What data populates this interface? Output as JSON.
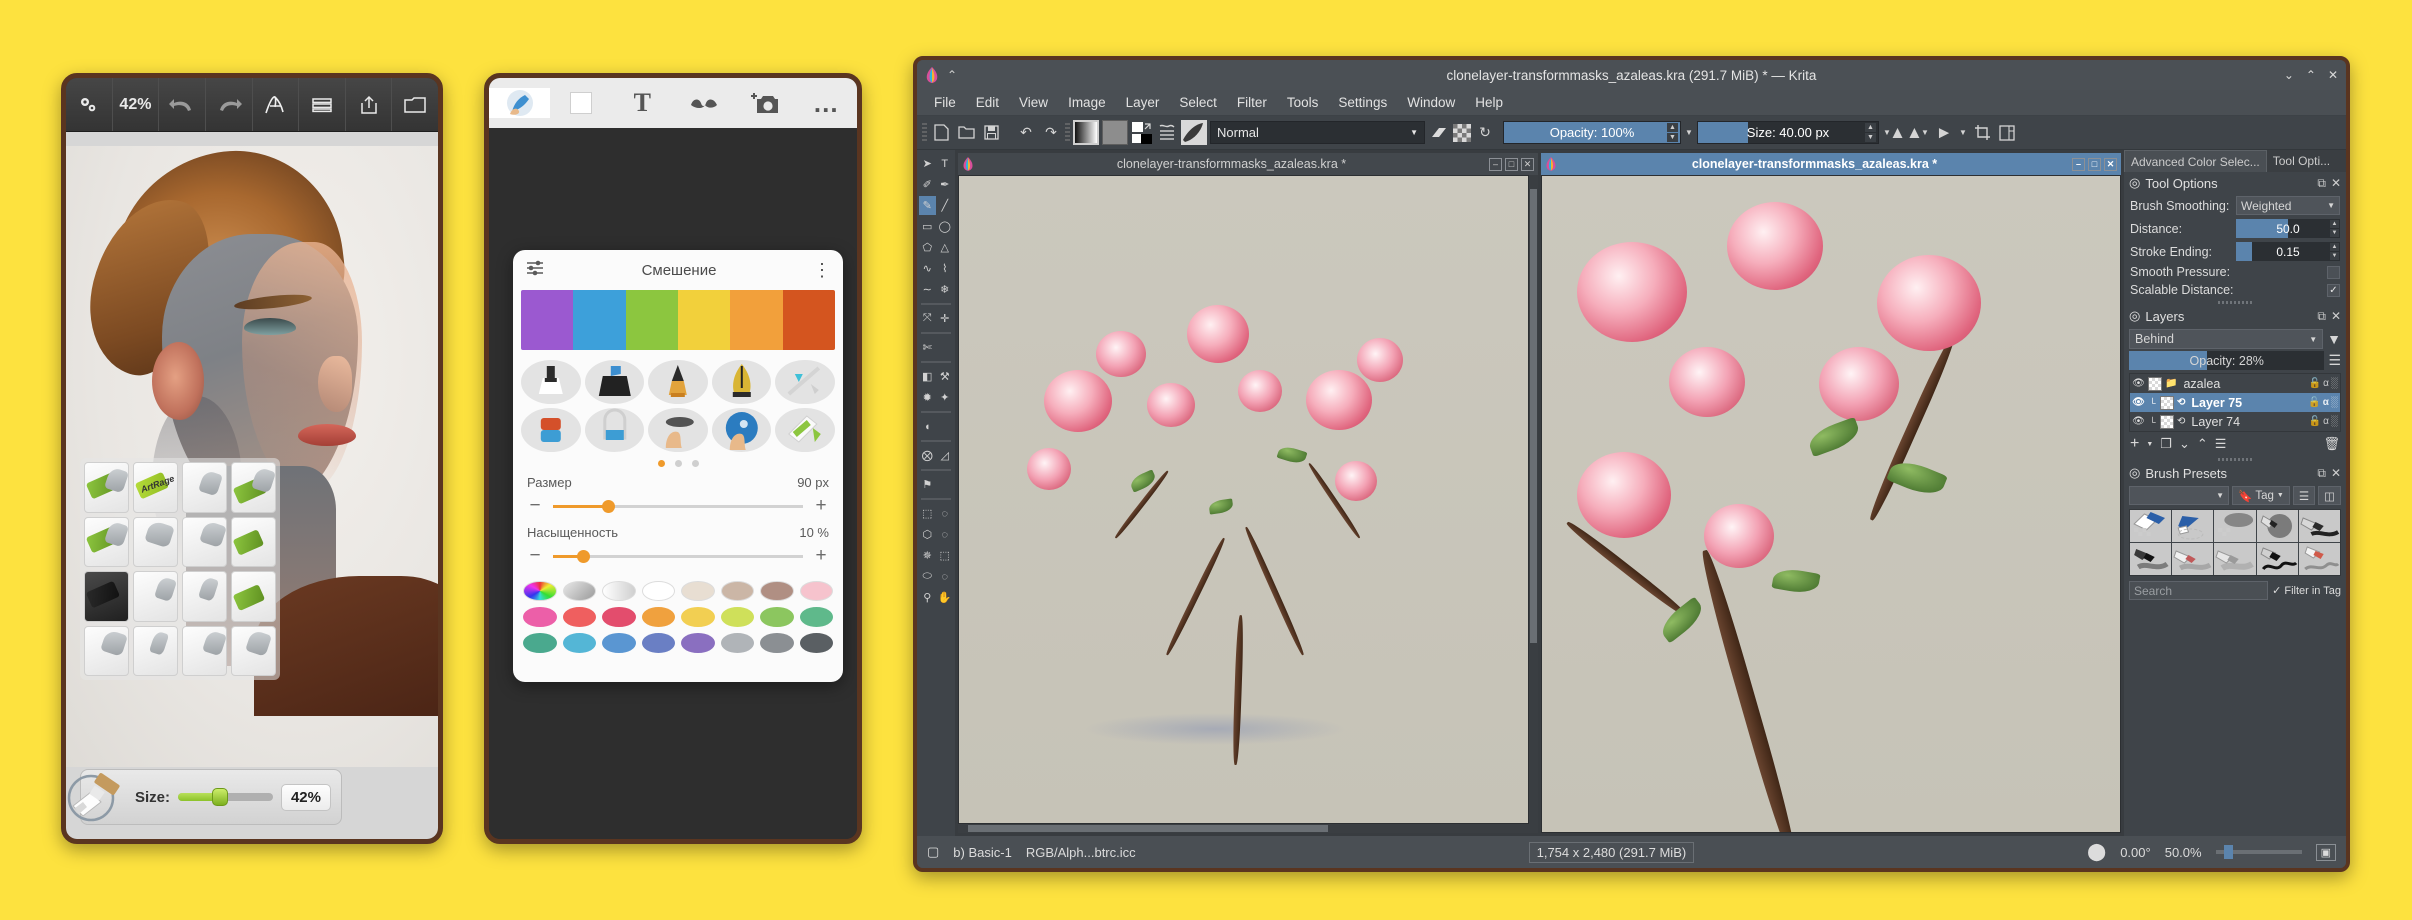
{
  "background_color": "#fde23f",
  "artrage": {
    "toolbar": [
      {
        "name": "settings-gears-icon",
        "glyph": "⚙"
      },
      {
        "name": "zoom-level",
        "glyph": "42%"
      },
      {
        "name": "undo-icon",
        "glyph": "↩"
      },
      {
        "name": "redo-icon",
        "glyph": "↪"
      },
      {
        "name": "brush-stroke-icon",
        "glyph": "Ж"
      },
      {
        "name": "layers-icon",
        "glyph": "☰"
      },
      {
        "name": "share-icon",
        "glyph": "⇧"
      },
      {
        "name": "gallery-icon",
        "glyph": "❐"
      }
    ],
    "size_label": "Size:",
    "size_value": "42%",
    "size_percent": 42,
    "brush_tile_label": "ArtRage"
  },
  "phone": {
    "toolbar": [
      {
        "name": "brush-preview-icon",
        "glyph": "●"
      },
      {
        "name": "color-swatch-white-icon",
        "glyph": "■"
      },
      {
        "name": "text-tool-icon",
        "glyph": "T"
      },
      {
        "name": "smudge-tool-icon",
        "glyph": "〜"
      },
      {
        "name": "add-photo-icon",
        "glyph": "▣"
      },
      {
        "name": "more-options-icon",
        "glyph": "…"
      }
    ],
    "mix_panel": {
      "settings_icon": "sliders-icon",
      "title": "Смешение",
      "menu_icon": "kebab-menu-icon",
      "gradient_swatches": [
        "#9b59d0",
        "#3da0da",
        "#8cc63f",
        "#f2d03b",
        "#f2a03b",
        "#d4551f"
      ],
      "brushes_row1": [
        "marker-icon",
        "flat-brush-icon",
        "pencil-icon",
        "fountain-pen-icon",
        "airbrush-icon"
      ],
      "brushes_row2": [
        "eraser-icon",
        "bucket-icon",
        "smudge-finger-icon",
        "blur-finger-icon",
        "palette-knife-icon"
      ],
      "page_dots": 3,
      "page_active": 0,
      "sliders": [
        {
          "label": "Размер",
          "value": "90 px",
          "percent": 22
        },
        {
          "label": "Насыщенность",
          "value": "10 %",
          "percent": 12
        }
      ],
      "palette_tools": [
        "color-wheel-icon",
        "eyedropper-icon",
        "opacity-icon"
      ],
      "palette_row0": [
        "#ffffff",
        "#e8ded2",
        "#cbb6a6",
        "#b08f83",
        "#f6c3cd"
      ],
      "palette_row1": [
        "#ec5fa8",
        "#ef5f5f",
        "#e34d6d",
        "#f0a13e",
        "#f2cf52",
        "#cfe05a",
        "#8cc65f",
        "#5fb98b"
      ],
      "palette_row2": [
        "#4aa98e",
        "#54b6d6",
        "#5a96d2",
        "#6a7fc4",
        "#8a6fc0",
        "#b0b4b8",
        "#8b8f93",
        "#5a5f63"
      ]
    }
  },
  "krita": {
    "window_title": "clonelayer-transformmasks_azaleas.kra (291.7 MiB) * — Krita",
    "window_buttons": [
      "⌄",
      "⌃",
      "✕"
    ],
    "menu": [
      "File",
      "Edit",
      "View",
      "Image",
      "Layer",
      "Select",
      "Filter",
      "Tools",
      "Settings",
      "Window",
      "Help"
    ],
    "toolbar": {
      "new_icon": "new-document-icon",
      "open_icon": "open-file-icon",
      "save_icon": "save-icon",
      "undo_icon": "undo-icon",
      "redo_icon": "redo-icon",
      "gradient_icon": "gradient-preview-icon",
      "pattern_icon": "pattern-preview-icon",
      "fg_bg_icon": "foreground-background-color-icon",
      "gradient_list_icon": "gradient-list-icon",
      "brush_preset_icon": "brush-preset-icon",
      "blend_mode": "Normal",
      "eraser_icon": "eraser-toggle-icon",
      "alpha_icon": "preserve-alpha-icon",
      "reload_icon": "reload-preset-icon",
      "opacity_label": "Opacity: 100%",
      "opacity_percent": 100,
      "size_label": "Size: 40.00 px",
      "size_percent": 28,
      "mirror_h_icon": "mirror-horizontal-icon",
      "mirror_v_icon": "mirror-vertical-icon",
      "wrap_icon": "wrap-around-icon",
      "workspace_icon": "workspace-switcher-icon"
    },
    "toolbox": [
      "select-shapes-icon",
      "text-icon",
      "edit-shapes-icon",
      "calligraphy-icon",
      "freehand-brush-icon",
      "line-icon",
      "rectangle-icon",
      "ellipse-icon",
      "polygon-icon",
      "polyline-icon",
      "bezier-curve-icon",
      "freehand-path-icon",
      "dynamic-brush-icon",
      "multibrush-icon",
      "transform-icon",
      "move-icon",
      "crop-icon",
      "gradient-icon",
      "color-picker-icon",
      "colorize-mask-icon",
      "smart-patch-icon",
      "fill-icon",
      "enclose-fill-icon",
      "measure-icon",
      "reference-images-icon",
      "rect-select-icon",
      "ellipse-select-icon",
      "polygonal-select-icon",
      "freehand-select-icon",
      "contiguous-select-icon",
      "magnetic-select-icon",
      "similar-select-icon",
      "bezier-select-icon",
      "zoom-icon",
      "pan-icon"
    ],
    "selected_tool": "freehand-brush-icon",
    "subwindows": [
      {
        "title": "clonelayer-transformmasks_azaleas.kra *",
        "active": false,
        "buttons": [
          "–",
          "□",
          "✕"
        ]
      },
      {
        "title": "clonelayer-transformmasks_azaleas.kra *",
        "active": true,
        "buttons": [
          "–",
          "□",
          "✕"
        ]
      }
    ],
    "dock_tabs": [
      {
        "label": "Advanced Color Selec...",
        "active": true
      },
      {
        "label": "Tool Opti...",
        "active": false
      }
    ],
    "tool_options": {
      "title": "Tool Options",
      "rows": [
        {
          "label": "Brush Smoothing:",
          "type": "combo",
          "value": "Weighted"
        },
        {
          "label": "Distance:",
          "type": "spin",
          "value": "50.0",
          "percent": 50
        },
        {
          "label": "Stroke Ending:",
          "type": "spin",
          "value": "0.15",
          "percent": 15
        },
        {
          "label": "Smooth Pressure:",
          "type": "check",
          "value": ""
        },
        {
          "label": "Scalable Distance:",
          "type": "check",
          "value": "✓"
        }
      ]
    },
    "layers": {
      "title": "Layers",
      "blend_mode": "Behind",
      "filter_icon": "filter-funnel-icon",
      "opacity_label": "Opacity:",
      "opacity_value": "28%",
      "opacity_percent": 28,
      "menu_icon": "hamburger-menu-icon",
      "rows": [
        {
          "name": "azalea",
          "selected": false,
          "group": true,
          "icons": [
            "🔓",
            "α",
            "░"
          ]
        },
        {
          "name": "Layer 75",
          "selected": true,
          "group": false,
          "icons": [
            "🔓",
            "α",
            "░"
          ]
        },
        {
          "name": "Layer 74",
          "selected": false,
          "group": false,
          "icons": [
            "🔓",
            "α",
            "░"
          ]
        }
      ],
      "buttons": [
        "add-layer-icon",
        "add-layer-dropdown-icon",
        "duplicate-layer-icon",
        "move-layer-down-icon",
        "move-layer-up-icon",
        "layer-properties-icon",
        "delete-layer-icon"
      ]
    },
    "brush_presets": {
      "title": "Brush Presets",
      "preset_combo": "",
      "tag_label": "Tag",
      "tag_icon": "bookmark-icon",
      "list_icon": "list-view-icon",
      "storage_icon": "resource-storage-icon",
      "thumbs_row1": [
        "eraser-soft-icon",
        "eraser-hard-icon",
        "eraser-small-icon",
        "ink-pen-icon",
        "ink-brush-icon"
      ],
      "thumbs_row2": [
        "ink-gpen-icon",
        "ink-fineliner-icon",
        "ink-marker-icon",
        "ink-tilt-icon",
        "ink-rough-icon"
      ],
      "search_placeholder": "Search",
      "filter_label": "Filter in Tag",
      "filter_checked": "✓"
    },
    "status_bar": {
      "preset_icon": "brush-preset-status-icon",
      "preset_name": "b) Basic-1",
      "color_profile": "RGB/Alph...btrc.icc",
      "dimensions": "1,754 x 2,480 (291.7 MiB)",
      "rotation_icon": "canvas-rotation-icon",
      "rotation": "0.00°",
      "zoom": "50.0%",
      "zoom_percent": 10,
      "fullscreen_icon": "fullscreen-toggle-icon"
    }
  }
}
